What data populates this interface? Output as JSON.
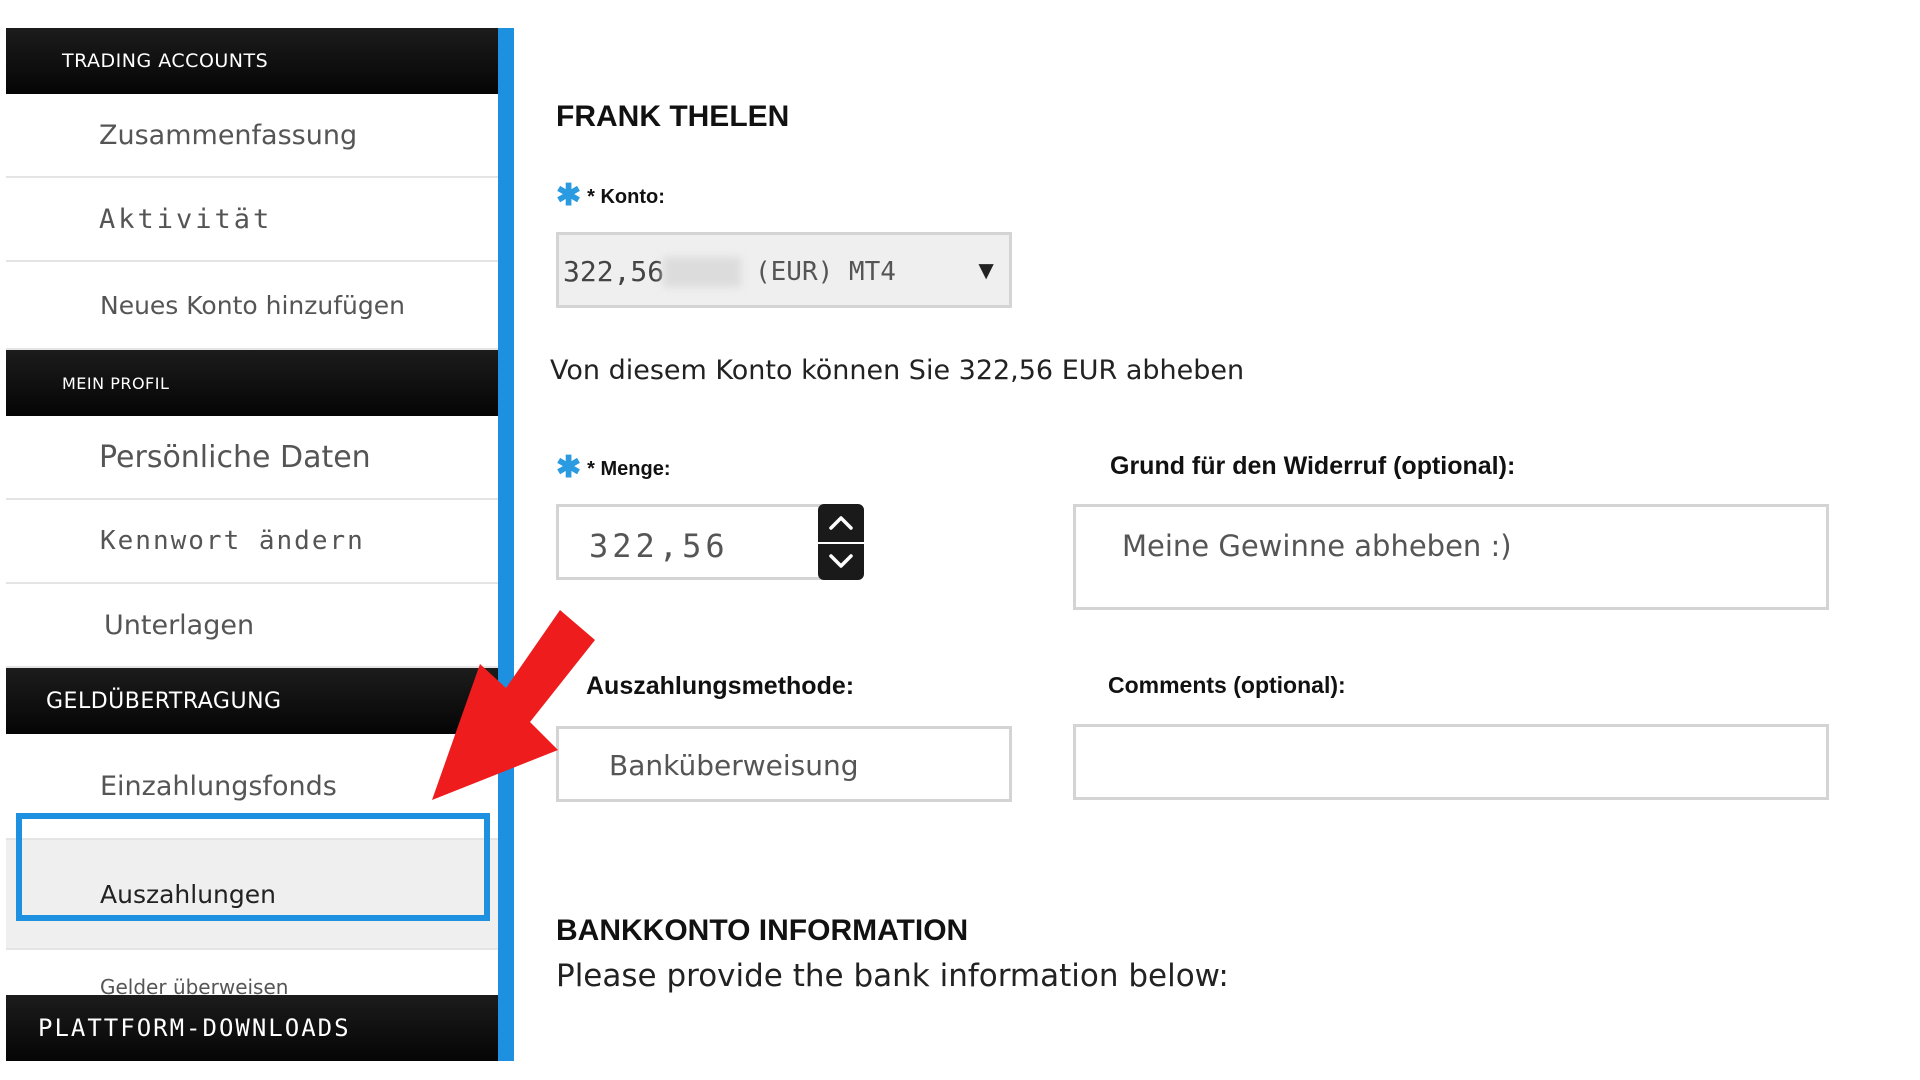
{
  "sidebar": {
    "sections": [
      {
        "title": "TRADING ACCOUNTS",
        "items": [
          "Zusammenfassung",
          "Aktivität",
          "Neues Konto hinzufügen"
        ]
      },
      {
        "title": "MEIN PROFIL",
        "items": [
          "Persönliche Daten",
          "Kennwort ändern",
          "Unterlagen"
        ]
      },
      {
        "title": "GELDÜBERTRAGUNG",
        "items": [
          "Einzahlungsfonds",
          "Auszahlungen",
          "Gelder überweisen"
        ]
      },
      {
        "title": "PLATTFORM-DOWNLOADS",
        "items": []
      }
    ],
    "active_item": "Auszahlungen",
    "accent_color": "#1e90e0"
  },
  "main": {
    "user_name": "FRANK THELEN",
    "konto": {
      "label": "* Konto:",
      "value_amount": "322,56",
      "value_suffix": "(EUR) MT4"
    },
    "available_text": "Von diesem Konto können Sie 322,56 EUR abheben",
    "menge": {
      "label": "* Menge:",
      "value": "322,56"
    },
    "grund": {
      "label": "Grund für den Widerruf (optional):",
      "value": "Meine Gewinne abheben :)"
    },
    "methode": {
      "label": "Auszahlungsmethode:",
      "value": "Banküberweisung"
    },
    "comments": {
      "label": "Comments (optional):",
      "value": ""
    },
    "bank": {
      "title": "BANKKONTO INFORMATION",
      "subtitle": "Please provide the bank information below:"
    }
  },
  "icons": {
    "required": "asterisk-icon",
    "dropdown": "caret-down-icon",
    "stepper_up": "chevron-up-icon",
    "stepper_down": "chevron-down-icon",
    "annotation": "red-arrow-icon"
  },
  "colors": {
    "accent": "#1e90e0",
    "required": "#2a9be0",
    "arrow": "#ee1c1c"
  }
}
